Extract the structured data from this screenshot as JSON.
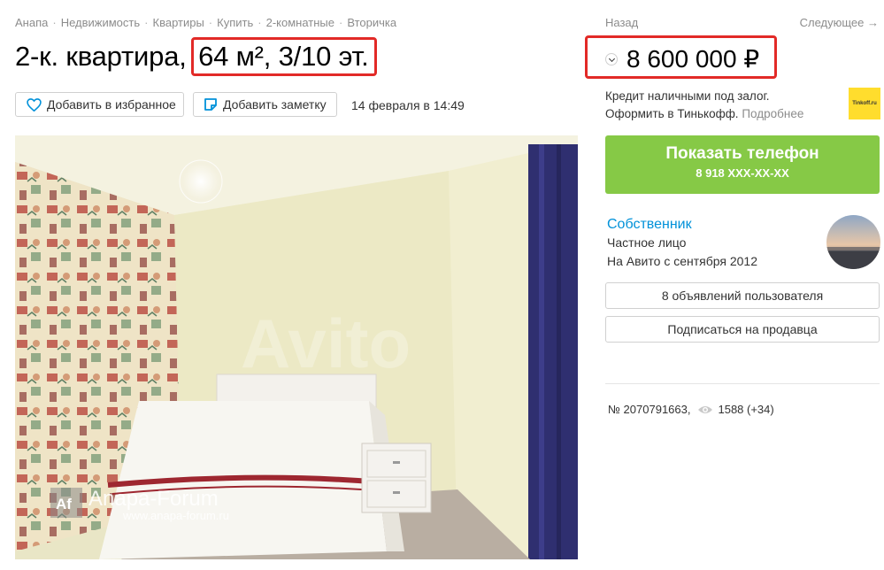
{
  "breadcrumb": [
    "Анапа",
    "Недвижимость",
    "Квартиры",
    "Купить",
    "2-комнатные",
    "Вторичка"
  ],
  "nav": {
    "back": "Назад",
    "next": "Следующее →"
  },
  "title": {
    "main": "2-к. квартира,",
    "highlight": "64 м², 3/10 эт."
  },
  "price": "8 600 000 ₽",
  "actions": {
    "favorite": "Добавить в избранное",
    "note": "Добавить заметку",
    "date": "14 февраля в 14:49"
  },
  "credit": {
    "line1": "Кредит наличными под залог.",
    "line2": "Оформить в Тинькофф.",
    "more": "Подробнее",
    "logo": "Tinkoff.ru"
  },
  "phone": {
    "label": "Показать телефон",
    "number": "8 918 XXX-XX-XX"
  },
  "seller": {
    "name": "Собственник",
    "type": "Частное лицо",
    "since": "На Авито с сентября 2012",
    "ads_button": "8 объявлений пользователя",
    "subscribe_button": "Подписаться на продавца"
  },
  "listing": {
    "id": "№ 2070791663,",
    "views": "1588 (+34)"
  },
  "photo": {
    "watermark": "Avito",
    "forum_name": "Anapa-Forum",
    "forum_url": "www.anapa-forum.ru",
    "forum_logo": "Af"
  },
  "colors": {
    "highlight": "#e22a27",
    "phone_button": "#86c946",
    "link": "#0091d9"
  }
}
